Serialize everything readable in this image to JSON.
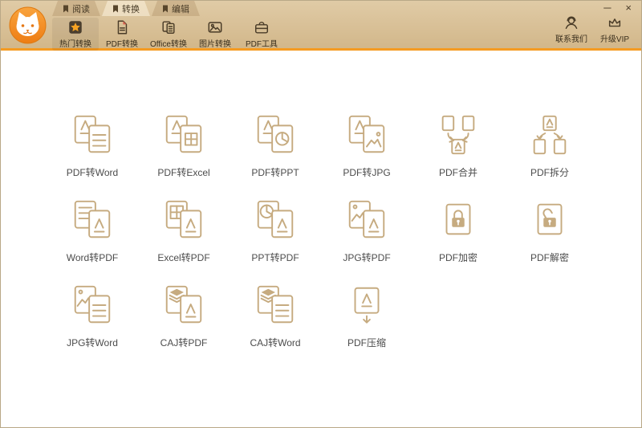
{
  "window": {
    "controls": {
      "minimize": "─",
      "close": "×"
    }
  },
  "logo": {
    "icon": "cat-logo-icon"
  },
  "tabs": [
    {
      "label": "阅读",
      "icon": "bookmark-icon",
      "active": false
    },
    {
      "label": "转换",
      "icon": "bookmark-icon",
      "active": true
    },
    {
      "label": "编辑",
      "icon": "bookmark-icon",
      "active": false
    }
  ],
  "toolbar": {
    "items": [
      {
        "label": "热门转换",
        "icon": "hot-star-icon",
        "active": true
      },
      {
        "label": "PDF转换",
        "icon": "pdf-convert-icon",
        "active": false
      },
      {
        "label": "Office转换",
        "icon": "office-convert-icon",
        "active": false
      },
      {
        "label": "图片转换",
        "icon": "image-convert-icon",
        "active": false
      },
      {
        "label": "PDF工具",
        "icon": "toolbox-icon",
        "active": false
      }
    ],
    "right": [
      {
        "label": "联系我们",
        "icon": "headset-icon"
      },
      {
        "label": "升级VIP",
        "icon": "crown-icon"
      }
    ]
  },
  "grid": {
    "items": [
      {
        "label": "PDF转Word",
        "icon": "pdf-to-word-icon"
      },
      {
        "label": "PDF转Excel",
        "icon": "pdf-to-excel-icon"
      },
      {
        "label": "PDF转PPT",
        "icon": "pdf-to-ppt-icon"
      },
      {
        "label": "PDF转JPG",
        "icon": "pdf-to-jpg-icon"
      },
      {
        "label": "PDF合并",
        "icon": "pdf-merge-icon"
      },
      {
        "label": "PDF拆分",
        "icon": "pdf-split-icon"
      },
      {
        "label": "Word转PDF",
        "icon": "word-to-pdf-icon"
      },
      {
        "label": "Excel转PDF",
        "icon": "excel-to-pdf-icon"
      },
      {
        "label": "PPT转PDF",
        "icon": "ppt-to-pdf-icon"
      },
      {
        "label": "JPG转PDF",
        "icon": "jpg-to-pdf-icon"
      },
      {
        "label": "PDF加密",
        "icon": "pdf-encrypt-icon"
      },
      {
        "label": "PDF解密",
        "icon": "pdf-decrypt-icon"
      },
      {
        "label": "JPG转Word",
        "icon": "jpg-to-word-icon"
      },
      {
        "label": "CAJ转PDF",
        "icon": "caj-to-pdf-icon"
      },
      {
        "label": "CAJ转Word",
        "icon": "caj-to-word-icon"
      },
      {
        "label": "PDF压缩",
        "icon": "pdf-compress-icon"
      }
    ]
  },
  "colors": {
    "topbar": "#d5b98c",
    "accent_orange": "#f59b22",
    "tile_stroke": "#c6ab80",
    "label_text": "#4c4c4c",
    "topbar_text": "#3a2f1d"
  }
}
